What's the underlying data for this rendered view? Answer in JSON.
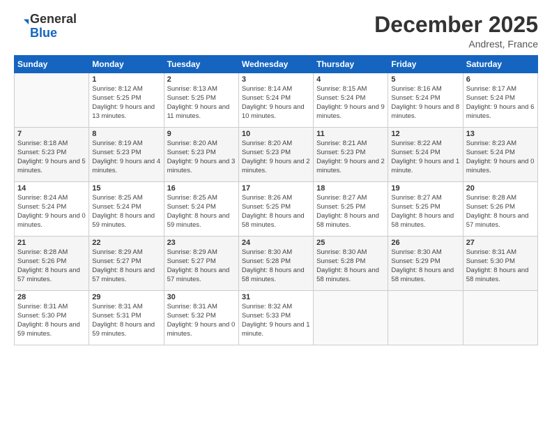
{
  "logo": {
    "general": "General",
    "blue": "Blue"
  },
  "header": {
    "month": "December 2025",
    "location": "Andrest, France"
  },
  "weekdays": [
    "Sunday",
    "Monday",
    "Tuesday",
    "Wednesday",
    "Thursday",
    "Friday",
    "Saturday"
  ],
  "weeks": [
    [
      {
        "day": "",
        "sunrise": "",
        "sunset": "",
        "daylight": ""
      },
      {
        "day": "1",
        "sunrise": "Sunrise: 8:12 AM",
        "sunset": "Sunset: 5:25 PM",
        "daylight": "Daylight: 9 hours and 13 minutes."
      },
      {
        "day": "2",
        "sunrise": "Sunrise: 8:13 AM",
        "sunset": "Sunset: 5:25 PM",
        "daylight": "Daylight: 9 hours and 11 minutes."
      },
      {
        "day": "3",
        "sunrise": "Sunrise: 8:14 AM",
        "sunset": "Sunset: 5:24 PM",
        "daylight": "Daylight: 9 hours and 10 minutes."
      },
      {
        "day": "4",
        "sunrise": "Sunrise: 8:15 AM",
        "sunset": "Sunset: 5:24 PM",
        "daylight": "Daylight: 9 hours and 9 minutes."
      },
      {
        "day": "5",
        "sunrise": "Sunrise: 8:16 AM",
        "sunset": "Sunset: 5:24 PM",
        "daylight": "Daylight: 9 hours and 8 minutes."
      },
      {
        "day": "6",
        "sunrise": "Sunrise: 8:17 AM",
        "sunset": "Sunset: 5:24 PM",
        "daylight": "Daylight: 9 hours and 6 minutes."
      }
    ],
    [
      {
        "day": "7",
        "sunrise": "Sunrise: 8:18 AM",
        "sunset": "Sunset: 5:23 PM",
        "daylight": "Daylight: 9 hours and 5 minutes."
      },
      {
        "day": "8",
        "sunrise": "Sunrise: 8:19 AM",
        "sunset": "Sunset: 5:23 PM",
        "daylight": "Daylight: 9 hours and 4 minutes."
      },
      {
        "day": "9",
        "sunrise": "Sunrise: 8:20 AM",
        "sunset": "Sunset: 5:23 PM",
        "daylight": "Daylight: 9 hours and 3 minutes."
      },
      {
        "day": "10",
        "sunrise": "Sunrise: 8:20 AM",
        "sunset": "Sunset: 5:23 PM",
        "daylight": "Daylight: 9 hours and 2 minutes."
      },
      {
        "day": "11",
        "sunrise": "Sunrise: 8:21 AM",
        "sunset": "Sunset: 5:23 PM",
        "daylight": "Daylight: 9 hours and 2 minutes."
      },
      {
        "day": "12",
        "sunrise": "Sunrise: 8:22 AM",
        "sunset": "Sunset: 5:24 PM",
        "daylight": "Daylight: 9 hours and 1 minute."
      },
      {
        "day": "13",
        "sunrise": "Sunrise: 8:23 AM",
        "sunset": "Sunset: 5:24 PM",
        "daylight": "Daylight: 9 hours and 0 minutes."
      }
    ],
    [
      {
        "day": "14",
        "sunrise": "Sunrise: 8:24 AM",
        "sunset": "Sunset: 5:24 PM",
        "daylight": "Daylight: 9 hours and 0 minutes."
      },
      {
        "day": "15",
        "sunrise": "Sunrise: 8:25 AM",
        "sunset": "Sunset: 5:24 PM",
        "daylight": "Daylight: 8 hours and 59 minutes."
      },
      {
        "day": "16",
        "sunrise": "Sunrise: 8:25 AM",
        "sunset": "Sunset: 5:24 PM",
        "daylight": "Daylight: 8 hours and 59 minutes."
      },
      {
        "day": "17",
        "sunrise": "Sunrise: 8:26 AM",
        "sunset": "Sunset: 5:25 PM",
        "daylight": "Daylight: 8 hours and 58 minutes."
      },
      {
        "day": "18",
        "sunrise": "Sunrise: 8:27 AM",
        "sunset": "Sunset: 5:25 PM",
        "daylight": "Daylight: 8 hours and 58 minutes."
      },
      {
        "day": "19",
        "sunrise": "Sunrise: 8:27 AM",
        "sunset": "Sunset: 5:25 PM",
        "daylight": "Daylight: 8 hours and 58 minutes."
      },
      {
        "day": "20",
        "sunrise": "Sunrise: 8:28 AM",
        "sunset": "Sunset: 5:26 PM",
        "daylight": "Daylight: 8 hours and 57 minutes."
      }
    ],
    [
      {
        "day": "21",
        "sunrise": "Sunrise: 8:28 AM",
        "sunset": "Sunset: 5:26 PM",
        "daylight": "Daylight: 8 hours and 57 minutes."
      },
      {
        "day": "22",
        "sunrise": "Sunrise: 8:29 AM",
        "sunset": "Sunset: 5:27 PM",
        "daylight": "Daylight: 8 hours and 57 minutes."
      },
      {
        "day": "23",
        "sunrise": "Sunrise: 8:29 AM",
        "sunset": "Sunset: 5:27 PM",
        "daylight": "Daylight: 8 hours and 57 minutes."
      },
      {
        "day": "24",
        "sunrise": "Sunrise: 8:30 AM",
        "sunset": "Sunset: 5:28 PM",
        "daylight": "Daylight: 8 hours and 58 minutes."
      },
      {
        "day": "25",
        "sunrise": "Sunrise: 8:30 AM",
        "sunset": "Sunset: 5:28 PM",
        "daylight": "Daylight: 8 hours and 58 minutes."
      },
      {
        "day": "26",
        "sunrise": "Sunrise: 8:30 AM",
        "sunset": "Sunset: 5:29 PM",
        "daylight": "Daylight: 8 hours and 58 minutes."
      },
      {
        "day": "27",
        "sunrise": "Sunrise: 8:31 AM",
        "sunset": "Sunset: 5:30 PM",
        "daylight": "Daylight: 8 hours and 58 minutes."
      }
    ],
    [
      {
        "day": "28",
        "sunrise": "Sunrise: 8:31 AM",
        "sunset": "Sunset: 5:30 PM",
        "daylight": "Daylight: 8 hours and 59 minutes."
      },
      {
        "day": "29",
        "sunrise": "Sunrise: 8:31 AM",
        "sunset": "Sunset: 5:31 PM",
        "daylight": "Daylight: 8 hours and 59 minutes."
      },
      {
        "day": "30",
        "sunrise": "Sunrise: 8:31 AM",
        "sunset": "Sunset: 5:32 PM",
        "daylight": "Daylight: 9 hours and 0 minutes."
      },
      {
        "day": "31",
        "sunrise": "Sunrise: 8:32 AM",
        "sunset": "Sunset: 5:33 PM",
        "daylight": "Daylight: 9 hours and 1 minute."
      },
      {
        "day": "",
        "sunrise": "",
        "sunset": "",
        "daylight": ""
      },
      {
        "day": "",
        "sunrise": "",
        "sunset": "",
        "daylight": ""
      },
      {
        "day": "",
        "sunrise": "",
        "sunset": "",
        "daylight": ""
      }
    ]
  ]
}
